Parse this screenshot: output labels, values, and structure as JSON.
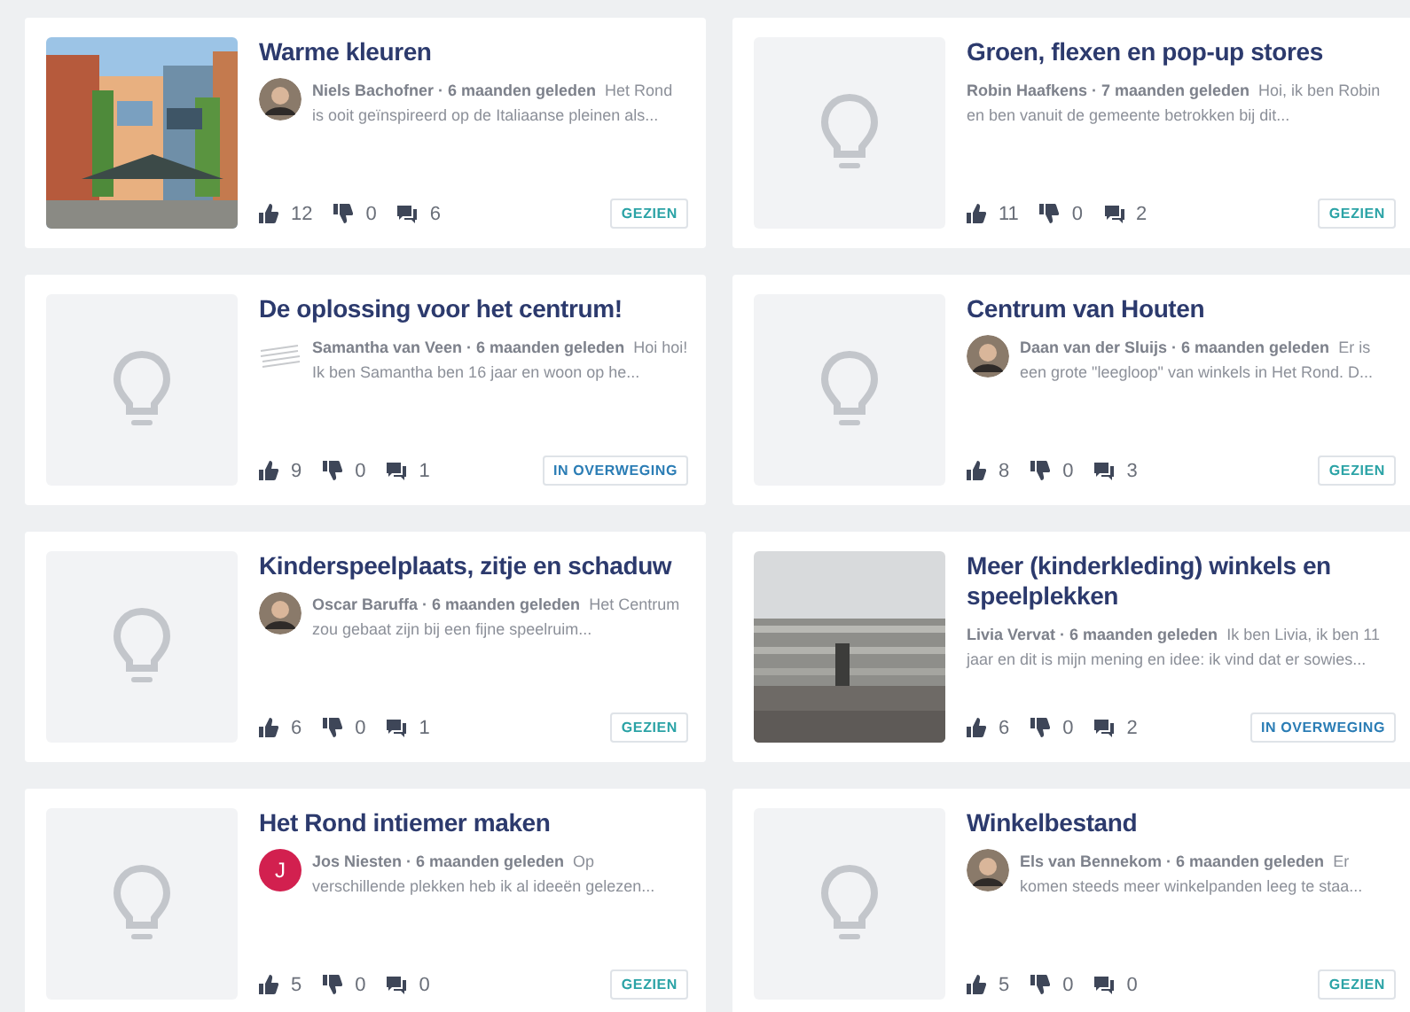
{
  "ideas": [
    {
      "title": "Warme kleuren",
      "byline": "Niels Bachofner · 6 maanden geleden",
      "excerpt": "Het Rond is ooit geïnspireerd op de Italiaanse pleinen als...",
      "likes": "12",
      "dislikes": "0",
      "comments": "6",
      "status": {
        "label": "GEZIEN",
        "color": "#2ba3a6"
      }
    },
    {
      "title": "Groen, flexen en pop-up stores",
      "thumbnail": {
        "kind": "placeholder"
      },
      "byline": "Robin Haafkens · 7 maanden geleden",
      "excerpt": "Hoi, ik ben Robin en ben vanuit de gemeente betrokken bij dit...",
      "likes": "11",
      "dislikes": "0",
      "comments": "2",
      "status": {
        "label": "GEZIEN",
        "color": "#2ba3a6"
      }
    },
    {
      "title": "De oplossing voor het centrum!",
      "thumbnail": {
        "kind": "placeholder"
      },
      "avatar": {
        "kind": "sketch"
      },
      "byline": "Samantha van Veen · 6 maanden geleden",
      "excerpt": "Hoi hoi! Ik ben Samantha ben 16 jaar en woon op he...",
      "likes": "9",
      "dislikes": "0",
      "comments": "1",
      "status": {
        "label": "IN OVERWEGING",
        "color": "#2b7db5"
      }
    },
    {
      "title": "Centrum van Houten",
      "thumbnail": {
        "kind": "placeholder"
      },
      "byline": "Daan van der Sluijs · 6 maanden geleden",
      "excerpt": "Er is een grote \"leegloop\" van winkels in Het Rond. D...",
      "likes": "8",
      "dislikes": "0",
      "comments": "3",
      "status": {
        "label": "GEZIEN",
        "color": "#2ba3a6"
      }
    },
    {
      "title": "Kinderspeelplaats, zitje en schaduw",
      "thumbnail": {
        "kind": "placeholder"
      },
      "byline": "Oscar Baruffa · 6 maanden geleden",
      "excerpt": "Het Centrum zou gebaat zijn bij een fijne speelruim...",
      "likes": "6",
      "dislikes": "0",
      "comments": "1",
      "status": {
        "label": "GEZIEN",
        "color": "#2ba3a6"
      }
    },
    {
      "title": "Meer (kinderkleding) winkels en speelplekken",
      "byline": "Livia Vervat · 6 maanden geleden",
      "excerpt": "Ik ben Livia, ik ben 11 jaar en dit is mijn mening en idee: ik vind dat er sowies...",
      "likes": "6",
      "dislikes": "0",
      "comments": "2",
      "status": {
        "label": "IN OVERWEGING",
        "color": "#2b7db5"
      }
    },
    {
      "title": "Het Rond intiemer maken",
      "thumbnail": {
        "kind": "placeholder"
      },
      "avatar": {
        "kind": "initial",
        "letter": "J"
      },
      "byline": "Jos Niesten · 6 maanden geleden",
      "excerpt": "Op verschillende plekken heb ik al ideeën gelezen...",
      "likes": "5",
      "dislikes": "0",
      "comments": "0",
      "status": {
        "label": "GEZIEN",
        "color": "#2ba3a6"
      }
    },
    {
      "title": "Winkelbestand",
      "thumbnail": {
        "kind": "placeholder"
      },
      "byline": "Els van Bennekom · 6 maanden geleden",
      "excerpt": "Er komen steeds meer winkelpanden leeg te staa...",
      "likes": "5",
      "dislikes": "0",
      "comments": "0",
      "status": {
        "label": "GEZIEN",
        "color": "#2ba3a6"
      }
    }
  ]
}
